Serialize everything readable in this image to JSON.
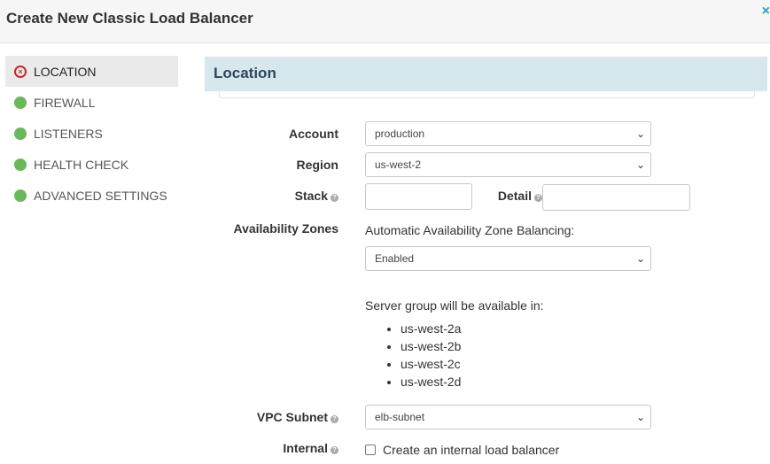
{
  "dialog": {
    "title": "Create New Classic Load Balancer",
    "close_icon": "×"
  },
  "nav": [
    {
      "label": "LOCATION",
      "status": "error"
    },
    {
      "label": "FIREWALL",
      "status": "ok"
    },
    {
      "label": "LISTENERS",
      "status": "ok"
    },
    {
      "label": "HEALTH CHECK",
      "status": "ok"
    },
    {
      "label": "ADVANCED SETTINGS",
      "status": "ok"
    }
  ],
  "section": {
    "title": "Location"
  },
  "form": {
    "account_label": "Account",
    "account_value": "production",
    "region_label": "Region",
    "region_value": "us-west-2",
    "stack_label": "Stack",
    "detail_label": "Detail",
    "az_label": "Availability Zones",
    "az_balancing_text": "Automatic Availability Zone Balancing:",
    "az_balancing_value": "Enabled",
    "server_group_text": "Server group will be available in:",
    "zones": [
      "us-west-2a",
      "us-west-2b",
      "us-west-2c",
      "us-west-2d"
    ],
    "vpc_label": "VPC Subnet",
    "vpc_value": "elb-subnet",
    "internal_label": "Internal",
    "internal_checkbox_text": "Create an internal load balancer",
    "help_glyph": "?",
    "chevron_glyph": "⌄"
  }
}
